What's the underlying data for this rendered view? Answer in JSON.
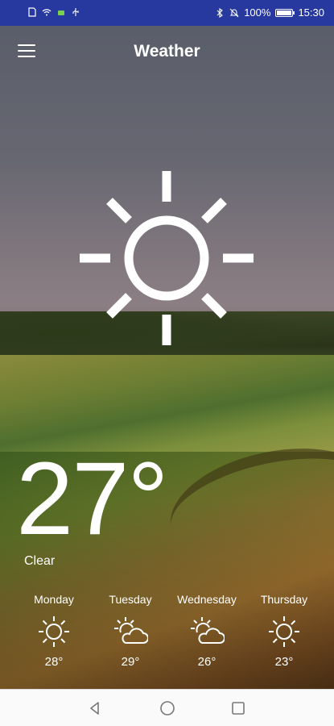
{
  "status_bar": {
    "battery": "100%",
    "time": "15:30",
    "icons": [
      "sim-icon",
      "wifi-icon",
      "android-icon",
      "usb-icon",
      "bluetooth-icon",
      "mute-icon",
      "battery-icon"
    ]
  },
  "app": {
    "title": "Weather",
    "menu_icon": "hamburger-menu-icon"
  },
  "current": {
    "temperature": "27°",
    "condition": "Clear",
    "icon": "sun-icon"
  },
  "forecast": [
    {
      "day": "Monday",
      "temp": "28°",
      "icon": "sun-icon"
    },
    {
      "day": "Tuesday",
      "temp": "29°",
      "icon": "partly-cloudy-icon"
    },
    {
      "day": "Wednesday",
      "temp": "26°",
      "icon": "partly-cloudy-icon"
    },
    {
      "day": "Thursday",
      "temp": "23°",
      "icon": "sun-icon"
    }
  ],
  "nav_bar": {
    "icons": [
      "back-icon",
      "home-icon",
      "recents-icon"
    ]
  },
  "colors": {
    "status_bar": "#27389e",
    "text": "#ffffff",
    "nav_bar": "#fafafa"
  }
}
